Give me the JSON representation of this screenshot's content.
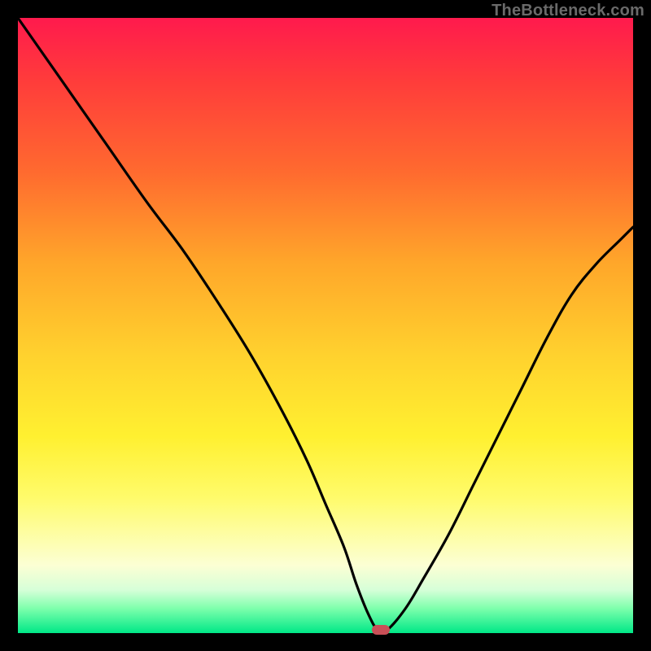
{
  "watermark": "TheBottleneck.com",
  "colors": {
    "frame": "#000000",
    "curve": "#000000",
    "marker": "#c94f57",
    "gradient_top": "#ff1a4d",
    "gradient_bottom": "#00e887"
  },
  "chart_data": {
    "type": "line",
    "title": "",
    "xlabel": "",
    "ylabel": "",
    "xlim": [
      0,
      100
    ],
    "ylim": [
      0,
      100
    ],
    "grid": false,
    "legend": false,
    "series": [
      {
        "name": "bottleneck-curve",
        "x": [
          0,
          7,
          14,
          21,
          27,
          33,
          38,
          43,
          47,
          50,
          53,
          55,
          57,
          58.5,
          60,
          63,
          66,
          70,
          74,
          78,
          82,
          86,
          90,
          94,
          98,
          100
        ],
        "values": [
          100,
          90,
          80,
          70,
          62,
          53,
          45,
          36,
          28,
          21,
          14,
          8,
          3,
          0.5,
          0.5,
          4,
          9,
          16,
          24,
          32,
          40,
          48,
          55,
          60,
          64,
          66
        ]
      }
    ],
    "marker": {
      "x": 59,
      "y": 0.5
    }
  }
}
